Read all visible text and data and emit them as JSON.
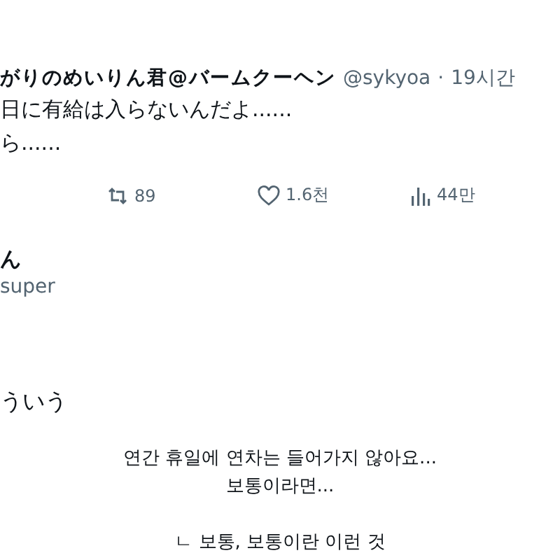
{
  "tweet": {
    "author_name": "がりのめいりん君@バームクーヘン",
    "handle": "@sykyoa",
    "separator": "·",
    "time": "19시간",
    "text_lines": [
      "日に有給は入らないんだよ......",
      "ら......"
    ],
    "actions": [
      {
        "kind": "retweet",
        "count": "89"
      },
      {
        "kind": "like",
        "count": "1.6천"
      },
      {
        "kind": "views",
        "count": "44만"
      }
    ]
  },
  "reply": {
    "author_name": "ん",
    "handle": "super",
    "text": "ういう"
  },
  "caption": {
    "lines": [
      "연간 휴일에 연차는 들어가지 않아요...",
      "보통이라면..."
    ],
    "note": "ㄴ 보통, 보통이란 이런 것"
  }
}
